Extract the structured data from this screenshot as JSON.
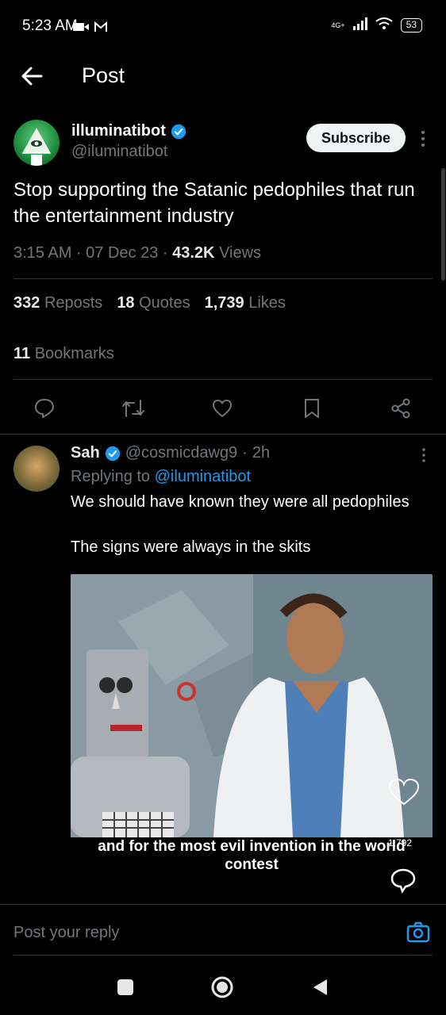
{
  "status_bar": {
    "time": "5:23 AM",
    "network": "4G+",
    "battery": "53"
  },
  "header": {
    "title": "Post"
  },
  "post": {
    "author_name": "illuminatibot",
    "author_handle": "@iluminatibot",
    "subscribe_label": "Subscribe",
    "text": "Stop supporting the Satanic pedophiles that run the entertainment industry",
    "time": "3:15 AM",
    "date": "07 Dec 23",
    "views_count": "43.2K",
    "views_label": "Views",
    "reposts_count": "332",
    "reposts_label": "Reposts",
    "quotes_count": "18",
    "quotes_label": "Quotes",
    "likes_count": "1,739",
    "likes_label": "Likes",
    "bookmarks_count": "11",
    "bookmarks_label": "Bookmarks"
  },
  "reply": {
    "name": "Sah",
    "handle": "@cosmicdawg9",
    "age": "2h",
    "replying_to_label": "Replying to",
    "replying_to_handle": "@iluminatibot",
    "text_line1": "We should have known they were all pedophiles",
    "text_line2": "The signs were always in the skits",
    "media_caption": "and for the most evil invention in the world contest",
    "media_like_count": "1,792"
  },
  "reply_bar": {
    "placeholder": "Post your reply"
  },
  "colors": {
    "background": "#000000",
    "accent": "#1d9bf0",
    "muted_text": "#71767b",
    "divider": "#2f3336"
  }
}
